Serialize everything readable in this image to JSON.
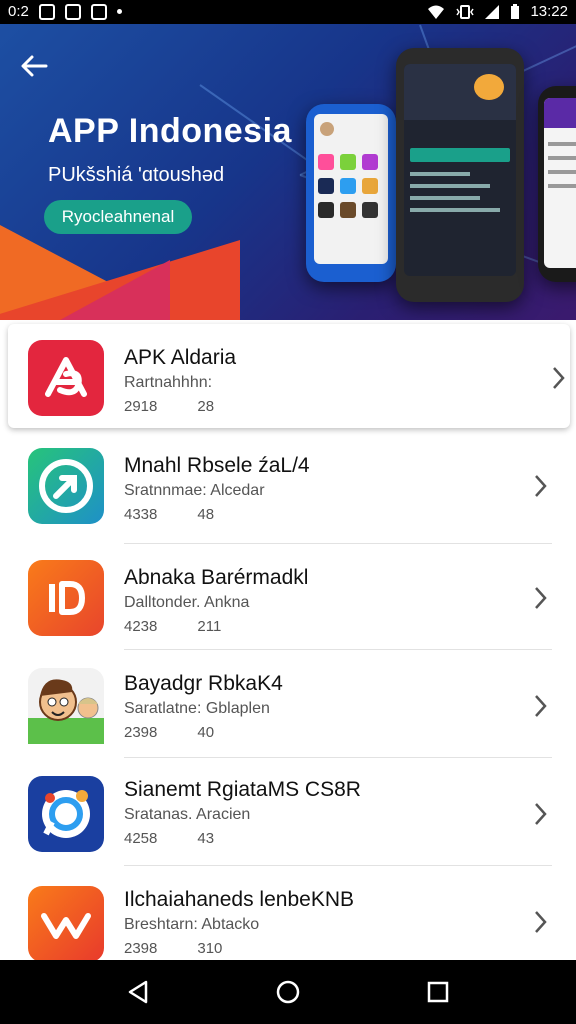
{
  "status_bar": {
    "time_left": "0:2",
    "time_right": "13:22"
  },
  "hero": {
    "title": "APP Indonesia",
    "subtitle": "PUkšshiá ʹɑtoushəd",
    "button_label": "Ryocleahnenal"
  },
  "apps": [
    {
      "name": "APK Aldaria",
      "meta": "Rartnahhhn:",
      "downloads": "2918",
      "rating": "28",
      "icon": "red-heart-logo-icon"
    },
    {
      "name": "Mnahl Rbsele źaL/4",
      "meta": "Sratnnmae: Alcedar",
      "downloads": "4338",
      "rating": "48",
      "icon": "green-arrow-logo-icon"
    },
    {
      "name": "Abnaka Barérmadkl",
      "meta": "Dalltonder. Anknа",
      "downloads": "4238",
      "rating": "211",
      "icon": "orange-d-logo-icon"
    },
    {
      "name": "Bayadgr RbkaK4",
      "meta": "Saratlatne: Gblaplen",
      "downloads": "2398",
      "rating": "40",
      "icon": "cartoon-face-icon"
    },
    {
      "name": "Sianemt RgiataMS CS8R",
      "meta": "Sratanas. Aracien",
      "downloads": "4258",
      "rating": "43",
      "icon": "blue-chat-circle-icon"
    },
    {
      "name": "Ilchaiahaneds lenbeKNB",
      "meta": "Breshtarn: Abtacko",
      "downloads": "2398",
      "rating": "310",
      "icon": "orange-k-logo-icon"
    }
  ],
  "colors": {
    "hero_gradient_start": "#1d4fa3",
    "hero_button": "#1aa08a",
    "accent_red": "#e8452c"
  }
}
